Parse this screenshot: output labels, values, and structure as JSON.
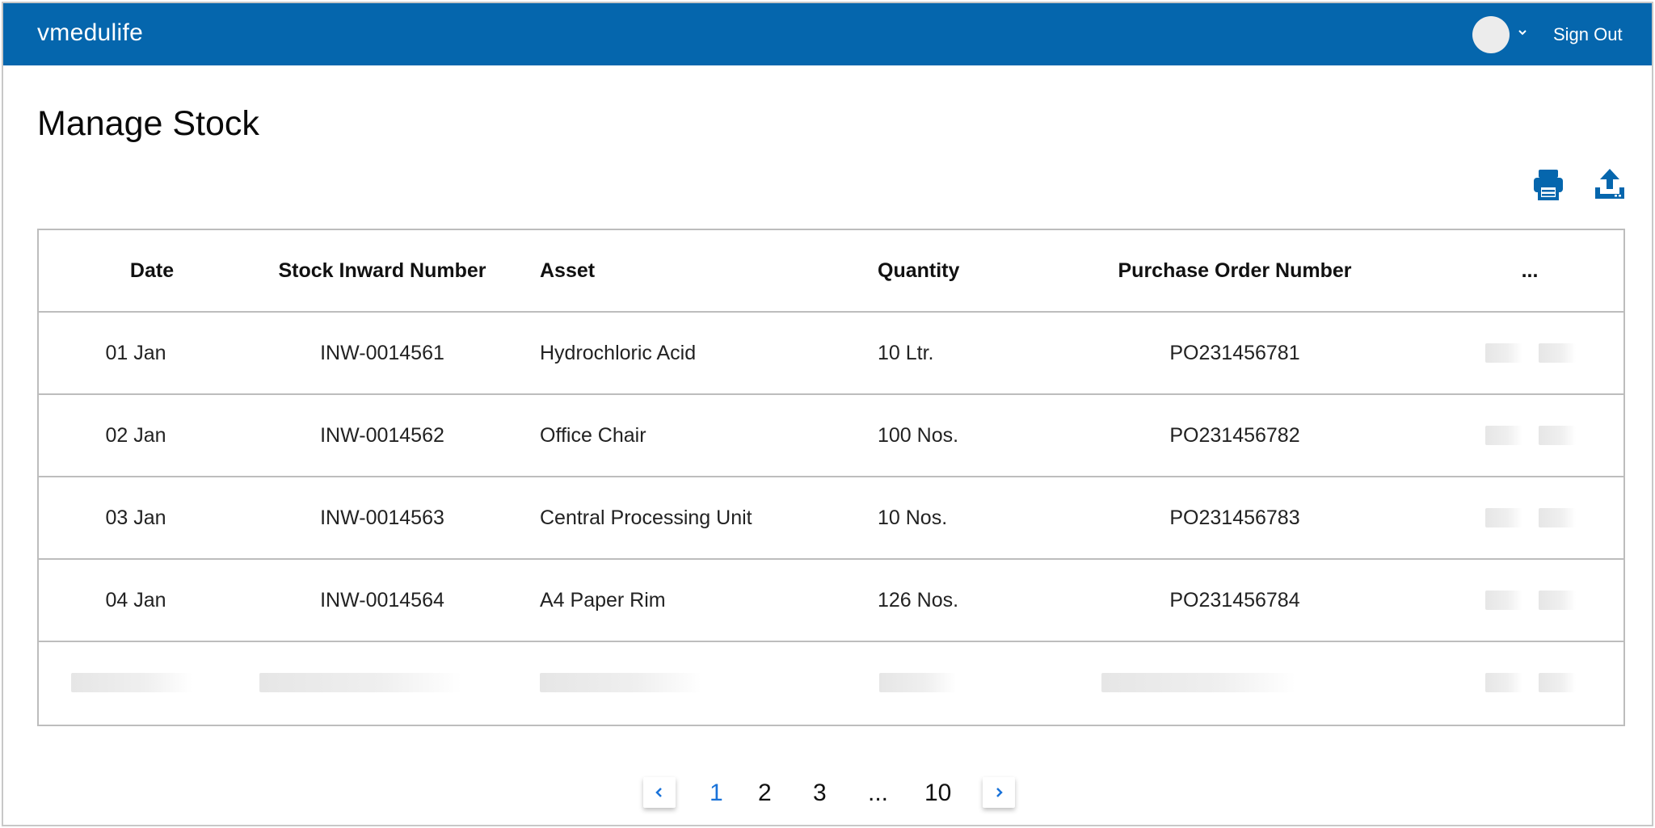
{
  "app": {
    "brand": "vmedulife",
    "sign_out": "Sign Out"
  },
  "page": {
    "title": "Manage Stock"
  },
  "toolbar": {
    "print_icon": "print-icon",
    "upload_icon": "upload-icon"
  },
  "table": {
    "headers": {
      "date": "Date",
      "inward": "Stock Inward Number",
      "asset": "Asset",
      "quantity": "Quantity",
      "po": "Purchase Order Number",
      "more": "..."
    },
    "rows": [
      {
        "date": "01 Jan",
        "inward": "INW-0014561",
        "asset": "Hydrochloric Acid",
        "quantity": "10 Ltr.",
        "po": "PO231456781"
      },
      {
        "date": "02 Jan",
        "inward": "INW-0014562",
        "asset": "Office Chair",
        "quantity": "100 Nos.",
        "po": "PO231456782"
      },
      {
        "date": "03 Jan",
        "inward": "INW-0014563",
        "asset": "Central Processing Unit",
        "quantity": "10 Nos.",
        "po": "PO231456783"
      },
      {
        "date": "04 Jan",
        "inward": "INW-0014564",
        "asset": "A4 Paper Rim",
        "quantity": "126 Nos.",
        "po": "PO231456784"
      }
    ]
  },
  "pagination": {
    "pages": [
      "1",
      "2",
      "3",
      "...",
      "10"
    ],
    "current": "1"
  },
  "colors": {
    "topbar": "#0566ad",
    "accent": "#1a73d9",
    "icon": "#0566ad"
  }
}
